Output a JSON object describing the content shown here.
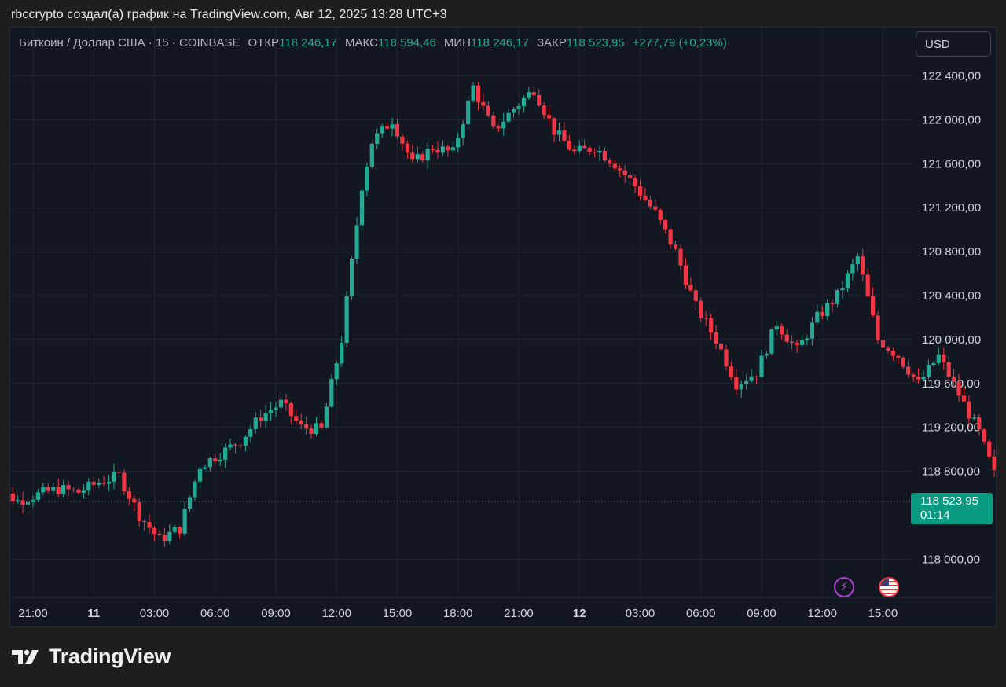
{
  "caption": "rbccrypto создал(а) график на TradingView.com, Авг 12, 2025 13:28 UTC+3",
  "legend": {
    "symbol": "Биткоин / Доллар США · 15 · COINBASE",
    "open_label": "ОТКР",
    "open_value": "118 246,17",
    "high_label": "МАКС",
    "high_value": "118 594,46",
    "low_label": "МИН",
    "low_value": "118 246,17",
    "close_label": "ЗАКР",
    "close_value": "118 523,95",
    "change": "+277,79 (+0,23%)"
  },
  "currency_button": "USD",
  "last_price": {
    "value": "118 523,95",
    "countdown": "01:14"
  },
  "brand": "TradingView",
  "icons": {
    "bolt": "lightning-bolt-icon",
    "flag": "us-flag-icon",
    "logo": "tradingview-logo-icon"
  },
  "colors": {
    "up": "#22ab94",
    "down": "#f23645",
    "background": "#131722",
    "grid": "#222632",
    "last_price_bg": "#089981"
  },
  "chart_data": {
    "type": "candlestick",
    "y_tick_labels": [
      "122 400,00",
      "122 000,00",
      "121 600,00",
      "121 200,00",
      "120 800,00",
      "120 400,00",
      "120 000,00",
      "119 600,00",
      "119 200,00",
      "118 800,00",
      "118 000,00"
    ],
    "x_tick_labels": [
      "21:00",
      "11",
      "03:00",
      "06:00",
      "09:00",
      "12:00",
      "15:00",
      "18:00",
      "21:00",
      "12",
      "03:00",
      "06:00",
      "09:00",
      "12:00",
      "15:00"
    ],
    "ylim": [
      117700,
      122900
    ],
    "last_price": 118523.95,
    "bar_interval_min": 15,
    "x_start_hour": 18.75,
    "open_ref": 118680,
    "close_path": [
      118680,
      118530,
      118590,
      118640,
      118610,
      118700,
      118760,
      118400,
      118180,
      118280,
      118850,
      118960,
      119080,
      119300,
      119420,
      119200,
      119180,
      120000,
      121400,
      121800,
      122000,
      121600,
      121750,
      121700,
      122300,
      121900,
      122100,
      122280,
      121900,
      121700,
      121750,
      121600,
      121400,
      121150,
      120800,
      120300,
      120000,
      119600,
      119700,
      120150,
      119900,
      120200,
      120400,
      120750,
      120000,
      119850,
      119600,
      119850,
      119500,
      119150,
      118650,
      118850,
      118800,
      118550,
      118200,
      118700,
      118800,
      118650,
      118700,
      118900,
      118950,
      118950,
      119000,
      118850,
      118950,
      118800,
      118750,
      118800,
      118950,
      119100,
      118800,
      118850,
      118950,
      118680,
      118380,
      118470
    ],
    "path_bars": [
      0,
      6,
      10,
      14,
      18,
      22,
      26,
      30,
      34,
      38,
      42,
      46,
      50,
      54,
      58,
      62,
      66,
      70,
      74,
      76,
      80,
      84,
      88,
      92,
      96,
      100,
      104,
      108,
      112,
      116,
      120,
      124,
      128,
      132,
      136,
      140,
      144,
      148,
      152,
      156,
      160,
      164,
      168,
      172,
      176,
      180,
      184,
      188,
      192,
      196,
      200,
      204,
      208,
      212,
      216,
      220,
      224,
      228,
      232,
      236,
      240,
      244,
      248,
      252,
      256,
      260,
      264,
      268,
      272,
      276,
      280,
      284,
      288,
      292,
      296,
      298
    ]
  }
}
